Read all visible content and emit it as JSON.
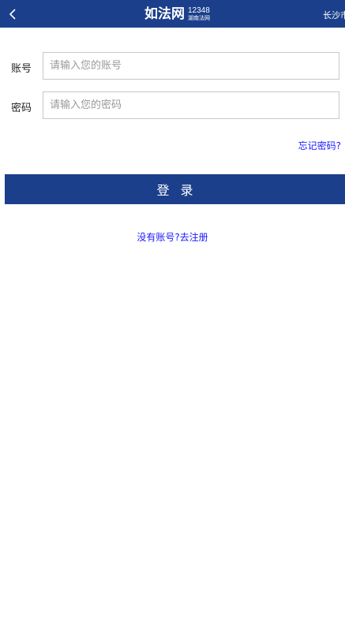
{
  "header": {
    "back_icon": "chevron-left-icon",
    "logo_main": "如法网",
    "logo_number": "12348",
    "logo_sub": "湖南法网",
    "city": "长沙市"
  },
  "form": {
    "account_label": "账号",
    "account_placeholder": "请输入您的账号",
    "account_value": "",
    "password_label": "密码",
    "password_placeholder": "请输入您的密码",
    "password_value": "",
    "forgot_link": "忘记密码?",
    "login_button": "登录",
    "register_text": "没有账号?去注册"
  },
  "colors": {
    "brand": "#1b3f8b",
    "link": "#1a1aff",
    "input_border": "#c8c8c8"
  }
}
